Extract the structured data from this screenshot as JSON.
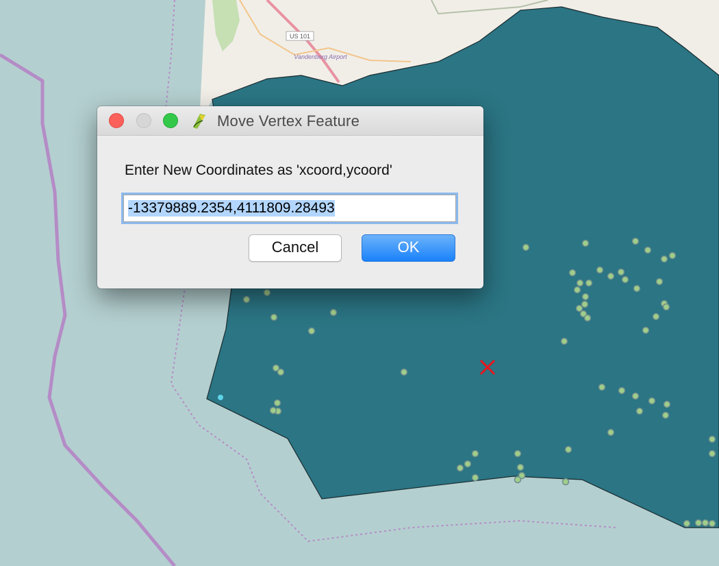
{
  "map": {
    "road_shield": "US 101",
    "place_label": "Vandenberg Airport",
    "colors": {
      "sea": "#b4cfd0",
      "land": "#f1eee8",
      "polygon": "#2b7584",
      "point": "#9fce8a",
      "marker": "#e8161d",
      "boundary": "#b48cc6"
    },
    "marker_icon": "red-x-marker"
  },
  "dialog": {
    "title": "Move Vertex Feature",
    "app_icon": "qgis-icon",
    "prompt": "Enter New Coordinates as 'xcoord,ycoord'",
    "input_value": "-13379889.2354,4111809.28493",
    "cancel_label": "Cancel",
    "ok_label": "OK"
  }
}
